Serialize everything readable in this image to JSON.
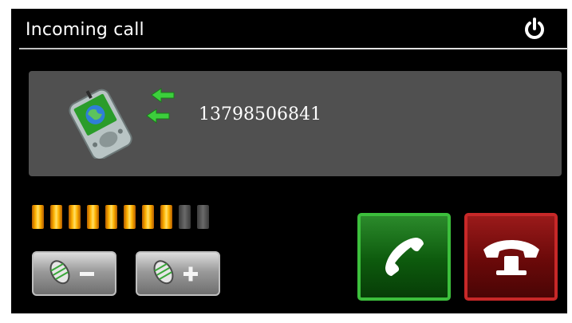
{
  "header": {
    "title": "Incoming call",
    "power_icon": "power-icon"
  },
  "caller": {
    "number": "13798506841",
    "device_icon": "pda-phone-icon",
    "arrow_icon": "incoming-arrows-icon"
  },
  "volume": {
    "level": 8,
    "max": 10,
    "active_color": "#ffb300",
    "inactive_color": "#5a5a5a",
    "down_icon": "microphone-minus-icon",
    "up_icon": "microphone-plus-icon"
  },
  "actions": {
    "answer_icon": "answer-phone-icon",
    "answer_color": "#1f7a1f",
    "hangup_icon": "hangup-phone-icon",
    "hangup_color": "#8a1212"
  }
}
